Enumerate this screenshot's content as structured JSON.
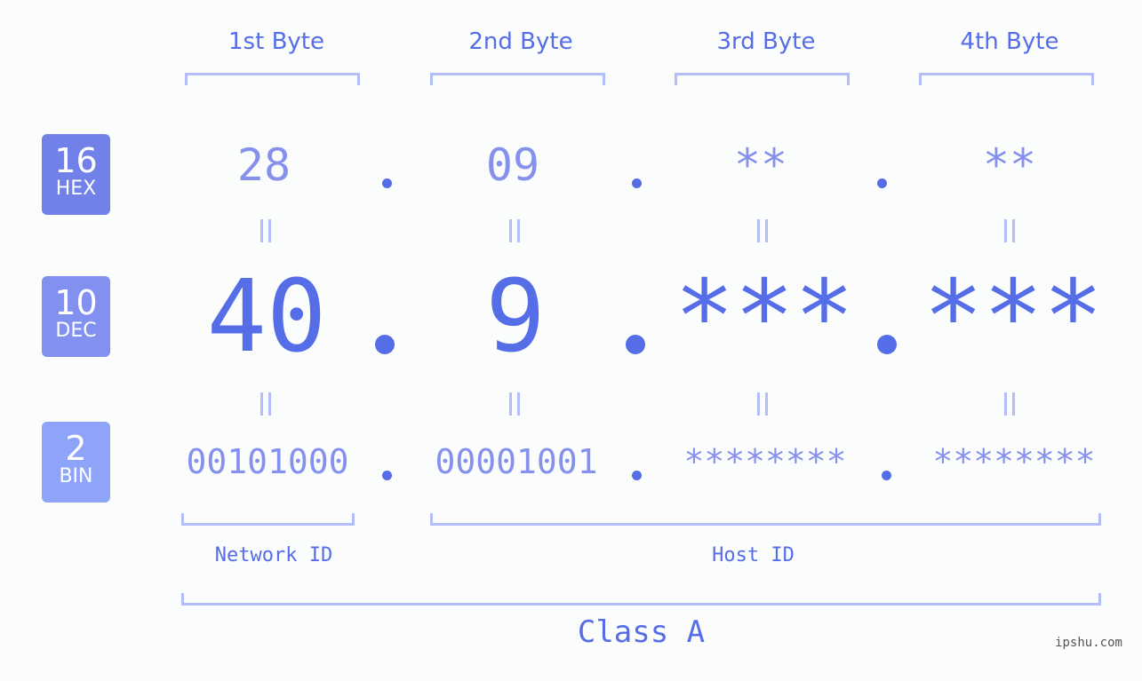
{
  "bytes": {
    "headers": [
      "1st Byte",
      "2nd Byte",
      "3rd Byte",
      "4th Byte"
    ]
  },
  "badges": {
    "hex": {
      "num": "16",
      "label": "HEX"
    },
    "dec": {
      "num": "10",
      "label": "DEC"
    },
    "bin": {
      "num": "2",
      "label": "BIN"
    }
  },
  "values": {
    "hex": [
      "28",
      "09",
      "**",
      "**"
    ],
    "dec": [
      "40",
      "9",
      "***",
      "***"
    ],
    "bin": [
      "00101000",
      "00001001",
      "********",
      "********"
    ]
  },
  "labels": {
    "network_id": "Network ID",
    "host_id": "Host ID",
    "class": "Class A"
  },
  "watermark": "ipshu.com",
  "colors": {
    "accent": "#566de8",
    "light_value": "#8591ed",
    "bracket": "#b3bdf7",
    "hex_badge": "#7281ea",
    "dec_badge": "#8291f0",
    "bin_badge": "#8ea4f8"
  }
}
